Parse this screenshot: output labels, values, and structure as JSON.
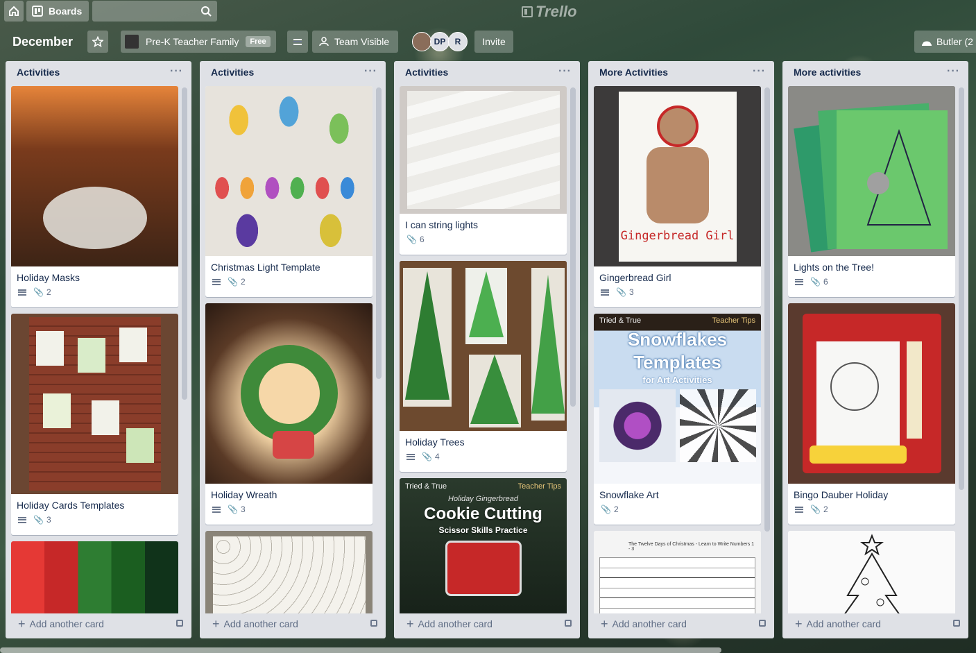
{
  "topbar": {
    "boards_label": "Boards",
    "search_placeholder": "",
    "logo_text": "Trello"
  },
  "board": {
    "title": "December",
    "team_name": "Pre-K Teacher Family",
    "team_badge": "Free",
    "visibility": "Team Visible",
    "members": [
      "DP",
      "R"
    ],
    "invite_label": "Invite",
    "butler_label": "Butler (2"
  },
  "lists": [
    {
      "title": "Activities",
      "menu": "···",
      "add_card": "Add another card",
      "cards": [
        {
          "title": "Holiday Masks",
          "desc": true,
          "attachments": "2",
          "cover_color": "#5a2b1b"
        },
        {
          "title": "Holiday Cards Templates",
          "desc": true,
          "attachments": "3",
          "cover_color": "#6b4632"
        },
        {
          "title": "",
          "desc": false,
          "attachments": "",
          "cover_color": "#c62828"
        }
      ]
    },
    {
      "title": "Activities",
      "menu": "···",
      "add_card": "Add another card",
      "cards": [
        {
          "title": "Christmas Light Template",
          "desc": true,
          "attachments": "2",
          "cover_color": "#d9d2c8"
        },
        {
          "title": "Holiday Wreath",
          "desc": true,
          "attachments": "3",
          "cover_color": "#3a2a20"
        },
        {
          "title": "",
          "desc": false,
          "attachments": "",
          "cover_color": "#8a8478"
        }
      ]
    },
    {
      "title": "Activities",
      "menu": "···",
      "add_card": "Add another card",
      "cards": [
        {
          "title": "I can string lights",
          "desc": false,
          "attachments": "6",
          "cover_color": "#c9c5c2"
        },
        {
          "title": "Holiday Trees",
          "desc": true,
          "attachments": "4",
          "cover_color": "#6d4a2f"
        },
        {
          "title": "",
          "desc": false,
          "attachments": "",
          "cover_color": "#1d2a1f",
          "cover_lines": [
            "Tried & True",
            "Teacher Tips",
            "Holiday Gingerbread",
            "Cookie Cutting",
            "Scissor Skills Practice"
          ]
        }
      ]
    },
    {
      "title": "More Activities",
      "menu": "···",
      "add_card": "Add another card",
      "cards": [
        {
          "title": "Gingerbread Girl",
          "desc": true,
          "attachments": "3",
          "cover_color": "#3c3a3a",
          "cover_lines": [
            "Gingerbread Girl"
          ]
        },
        {
          "title": "Snowflake Art",
          "desc": false,
          "attachments": "2",
          "cover_color": "#bcd3ec",
          "cover_lines": [
            "Tried & True",
            "Teacher Tips",
            "Snowflakes",
            "Templates",
            "for Art Activities"
          ]
        },
        {
          "title": "",
          "desc": false,
          "attachments": "",
          "cover_color": "#f4f4f4",
          "cover_lines": [
            "The Twelve Days of Christmas - Learn to Write Numbers 1 - 3"
          ]
        }
      ]
    },
    {
      "title": "More activities",
      "menu": "···",
      "add_card": "Add another card",
      "cards": [
        {
          "title": "Lights on the Tree!",
          "desc": true,
          "attachments": "6",
          "cover_color": "#55a862"
        },
        {
          "title": "Bingo Dauber Holiday",
          "desc": true,
          "attachments": "2",
          "cover_color": "#a1241f"
        },
        {
          "title": "",
          "desc": false,
          "attachments": "",
          "cover_color": "#fafafa"
        }
      ]
    }
  ]
}
